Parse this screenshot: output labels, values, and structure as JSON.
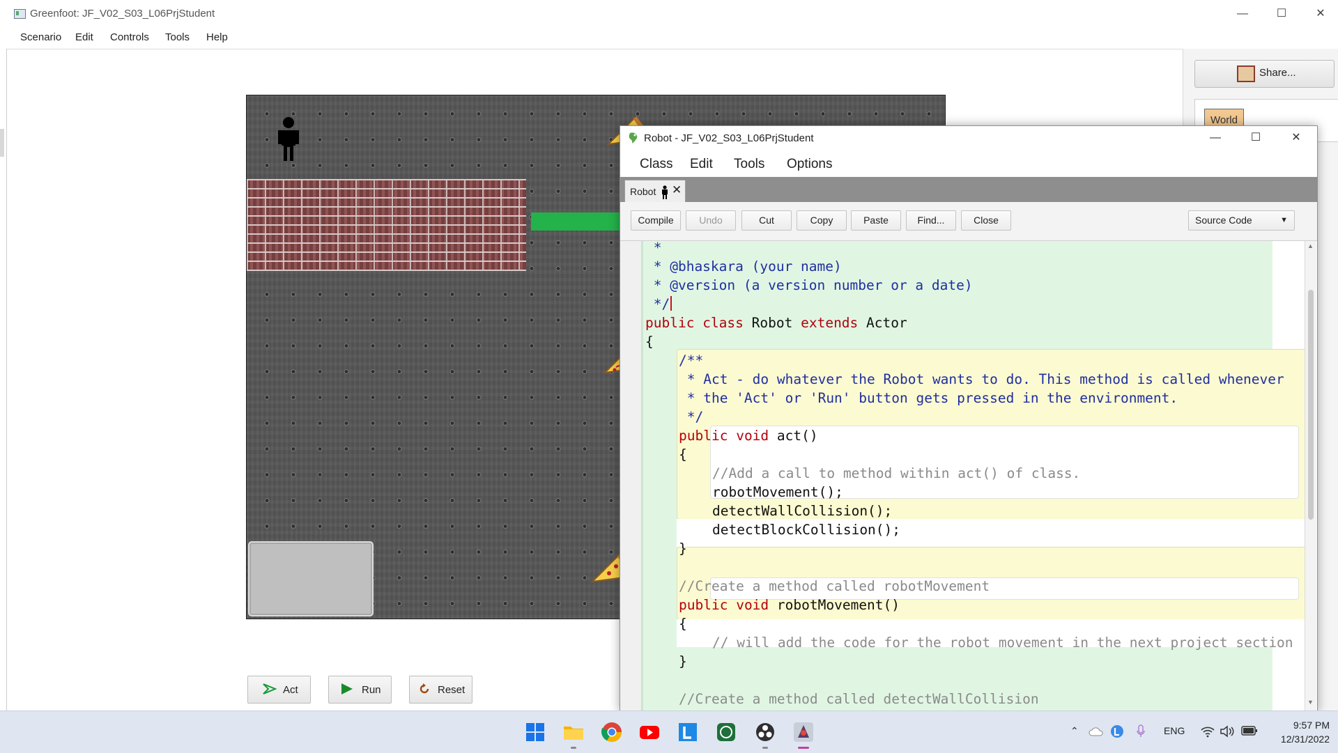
{
  "main_window": {
    "title": "Greenfoot: JF_V02_S03_L06PrjStudent",
    "menu": [
      "Scenario",
      "Edit",
      "Controls",
      "Tools",
      "Help"
    ],
    "share_label": "Share...",
    "world_class_label": "World",
    "controls": {
      "act": "Act",
      "run": "Run",
      "reset": "Reset"
    }
  },
  "editor": {
    "title": "Robot - JF_V02_S03_L06PrjStudent",
    "menu": [
      "Class",
      "Edit",
      "Tools",
      "Options"
    ],
    "tab_label": "Robot",
    "toolbar": [
      "Compile",
      "Undo",
      "Cut",
      "Copy",
      "Paste",
      "Find...",
      "Close"
    ],
    "view_select": "Source Code",
    "code_lines": [
      " *",
      " * @bhaskara (your name)",
      " * @version (a version number or a date)",
      " */",
      "public class Robot extends Actor",
      "{",
      "/**",
      " * Act - do whatever the Robot wants to do. This method is called whenever",
      " * the 'Act' or 'Run' button gets pressed in the environment.",
      " */",
      "public void act()",
      "{",
      "//Add a call to method within act() of class.",
      "robotMovement();",
      "detectWallCollision();",
      "detectBlockCollision();",
      "}",
      "//Create a method called robotMovement",
      "public void robotMovement()",
      "{",
      "// will add the code for the robot movement in the next project section",
      "}",
      "//Create a method called detectWallCollision"
    ]
  },
  "taskbar": {
    "language": "ENG",
    "time": "9:57 PM",
    "date": "12/31/2022",
    "apps": [
      "start-icon",
      "file-explorer-icon",
      "chrome-icon",
      "youtube-icon",
      "l-app-icon",
      "whatsapp-icon",
      "obs-icon",
      "greenfoot-icon"
    ]
  },
  "colors": {
    "keyword": "#b3000c",
    "javadoc": "#1f2fa0",
    "comment": "#8a8a8a",
    "class_scope": "#e0f6e3",
    "method_scope": "#fcfad0",
    "green_bar": "#24b24a"
  }
}
